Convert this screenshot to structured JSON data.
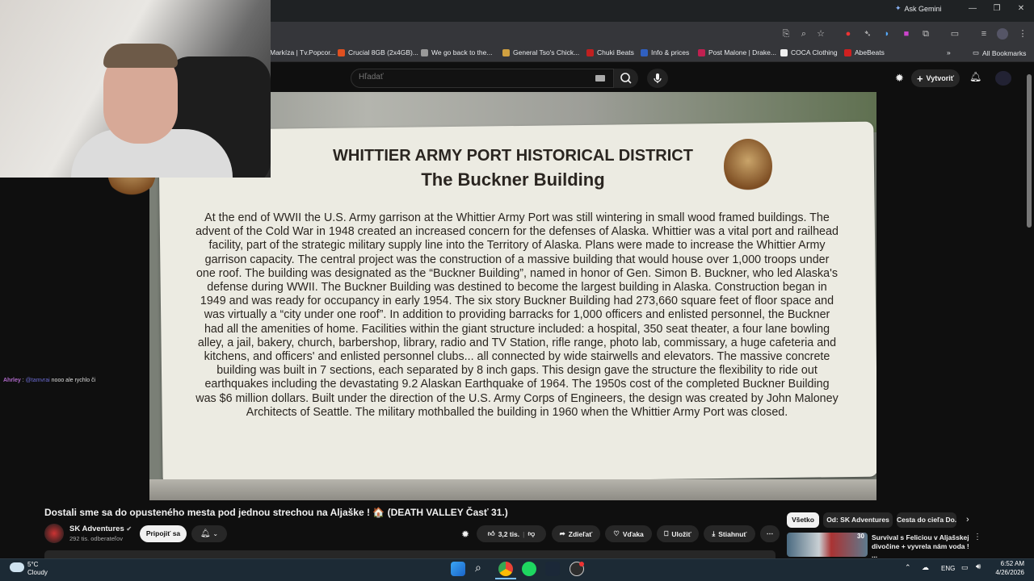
{
  "browser": {
    "ask_gemini": "Ask Gemini",
    "bookmarks": [
      {
        "label": "Markíza | Tv.Popcor...",
        "color": "#e03030"
      },
      {
        "label": "Crucial 8GB (2x4GB)...",
        "color": "#e05020"
      },
      {
        "label": "We go back to the...",
        "color": "#999999"
      },
      {
        "label": "General Tso's Chick...",
        "color": "#d0a040"
      },
      {
        "label": "Chuki Beats",
        "color": "#c02020"
      },
      {
        "label": "Info & prices",
        "color": "#3060c0"
      },
      {
        "label": "Post Malone | Drake...",
        "color": "#c02050"
      },
      {
        "label": "COCA Clothing",
        "color": "#eeeeee"
      },
      {
        "label": "AbeBeats",
        "color": "#d02020"
      }
    ],
    "all_bookmarks": "All Bookmarks"
  },
  "youtube": {
    "search_placeholder": "Hľadať",
    "create_label": "Vytvoriť"
  },
  "video": {
    "sign_title_1": "WHITTIER ARMY PORT HISTORICAL DISTRICT",
    "sign_title_2": "The Buckner Building",
    "sign_body": "At the end of WWII the U.S. Army garrison at the Whittier Army Port was still wintering in small wood framed buildings. The advent of the Cold War in 1948 created an increased concern for the defenses of Alaska. Whittier was a vital port and railhead facility, part of the strategic military supply line into the Territory of Alaska. Plans were made to increase the Whittier Army garrison capacity. The central project was the construction of a massive building that would house over 1,000 troops under one roof. The building was designated as the “Buckner Building”, named in honor of Gen. Simon B. Buckner, who led Alaska's defense during WWII. The Buckner Building was destined to become the largest building in Alaska. Construction began in 1949 and was ready for occupancy in early 1954. The six story Buckner Building had 273,660 square feet of floor space and was virtually a “city under one roof”. In addition to providing barracks for 1,000 officers and enlisted personnel, the Buckner had all the amenities of home. Facilities within the giant structure included: a hospital, 350 seat theater, a four lane bowling alley, a jail, bakery, church, barbershop, library, radio and TV Station, rifle range, photo lab, commissary, a huge cafeteria and kitchens, and officers' and enlisted personnel clubs... all connected by wide stairwells and elevators. The massive concrete building was built in 7 sections, each separated by 8 inch gaps. This design gave the structure the flexibility to ride out earthquakes including the devastating 9.2 Alaskan Earthquake of 1964. The 1950s cost of the completed Buckner Building was $6 million dollars. Built under the direction of the U.S. Army Corps of Engineers, the design was created by John Maloney Architects of Seattle. The military mothballed the building in 1960 when the Whittier Army Port was closed."
  },
  "chat": {
    "user": "Ahrley",
    "mention": "@tamvrai",
    "message": "nooo ale rychlo či"
  },
  "info": {
    "title": "Dostali sme sa do opusteného mesta pod jednou strechou na Aljaške ! 🏠 (DEATH VALLEY Časť 31.)",
    "channel": "SK Adventures",
    "subscribers": "292 tis. odberateľov",
    "join": "Pripojiť sa",
    "likes": "3,2 tis.",
    "share": "Zdieľať",
    "thanks": "Vďaka",
    "save": "Uložiť",
    "download": "Stiahnuť"
  },
  "sidebar": {
    "chips": [
      "Všetko",
      "Od: SK Adventures",
      "Cesta do cieľa Do..."
    ],
    "rec_title": "Survival s Feliciou v Aljašskej divočine + vyvrela nám voda ! ...",
    "rec_badge": "30"
  },
  "taskbar": {
    "temp": "5°C",
    "weather": "Cloudy",
    "lang": "ENG",
    "time": "6:52 AM",
    "date": "4/26/2026"
  }
}
